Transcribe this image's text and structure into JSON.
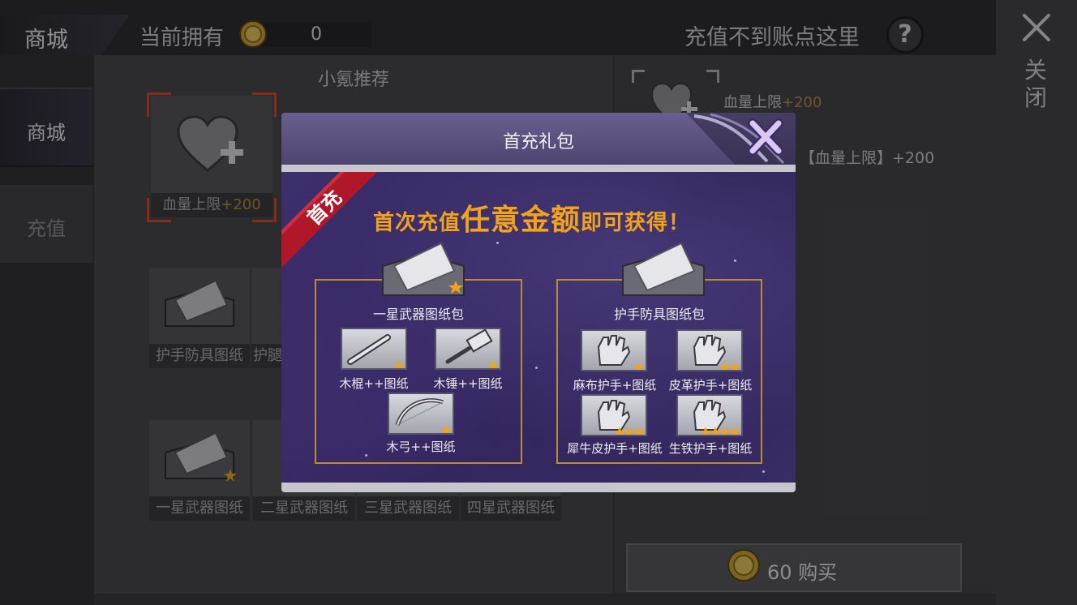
{
  "header": {
    "shop_title": "商城",
    "owned_label": "当前拥有",
    "owned_value": "0",
    "recharge_help_text": "充值不到账点这里",
    "help_label": "?"
  },
  "close_panel": {
    "label": "关闭"
  },
  "sidebar": {
    "tabs": [
      {
        "label": "商城",
        "selected": true
      },
      {
        "label": "充值",
        "selected": false
      }
    ]
  },
  "shop": {
    "section_title": "小氪推荐",
    "featured": {
      "name": "血量上限",
      "bonus": "+200"
    },
    "row2": [
      {
        "label": "护手防具图纸"
      },
      {
        "label": "护腿"
      }
    ],
    "row3": [
      {
        "label": "一星武器图纸"
      },
      {
        "label": "二星武器图纸"
      },
      {
        "label": "三星武器图纸"
      },
      {
        "label": "四星武器图纸"
      }
    ]
  },
  "detail": {
    "name": "血量上限",
    "bonus": "+200",
    "effect": "【血量上限】+200",
    "buy_price": "60",
    "buy_label": "购买"
  },
  "modal": {
    "title": "首充礼包",
    "ribbon": "首充",
    "headline_1": "首次充值",
    "headline_2": "任意金额",
    "headline_3": "即可获得！",
    "packs": [
      {
        "title": "一星武器图纸包",
        "items": [
          {
            "label": "木棍++图纸",
            "stars": 1
          },
          {
            "label": "木锤++图纸",
            "stars": 1
          },
          {
            "label": "木弓++图纸",
            "stars": 1
          }
        ]
      },
      {
        "title": "护手防具图纸包",
        "items": [
          {
            "label": "麻布护手+图纸",
            "stars": 1
          },
          {
            "label": "皮革护手+图纸",
            "stars": 2
          },
          {
            "label": "犀牛皮护手+图纸",
            "stars": 3
          },
          {
            "label": "生铁护手+图纸",
            "stars": 4
          }
        ]
      }
    ]
  },
  "colors": {
    "accent_gold": "#f2a31b",
    "selection_red": "#d44a2a",
    "modal_purple": "#3e2f6e",
    "ribbon_red": "#b0182a"
  }
}
